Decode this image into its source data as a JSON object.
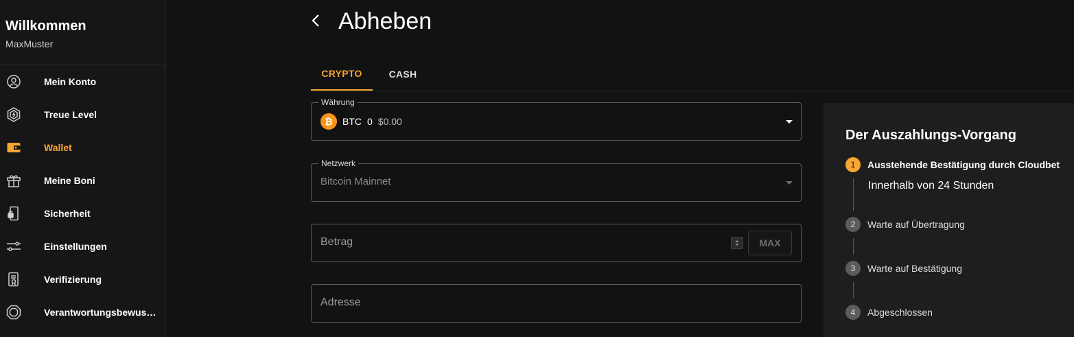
{
  "sidebar": {
    "welcome_title": "Willkommen",
    "username": "MaxMuster",
    "active_color": "#f7a533",
    "items": [
      {
        "label": "Mein Konto",
        "icon": "user-circle-icon"
      },
      {
        "label": "Treue Level",
        "icon": "badge-hexagon-icon"
      },
      {
        "label": "Wallet",
        "icon": "wallet-icon"
      },
      {
        "label": "Meine Boni",
        "icon": "gift-icon"
      },
      {
        "label": "Sicherheit",
        "icon": "phone-lock-icon"
      },
      {
        "label": "Einstellungen",
        "icon": "sliders-icon"
      },
      {
        "label": "Verifizierung",
        "icon": "document-check-icon"
      },
      {
        "label": "Verantwortungsbewuss…",
        "icon": "octagon-icon"
      }
    ]
  },
  "header": {
    "title": "Abheben",
    "back_icon": "chevron-left-icon"
  },
  "tabs": [
    {
      "label": "CRYPTO",
      "active": true
    },
    {
      "label": "CASH",
      "active": false
    }
  ],
  "form": {
    "currency": {
      "legend": "Währung",
      "coin_symbol": "₿",
      "code": "BTC",
      "amount": "0",
      "usd_value": "$0.00"
    },
    "network": {
      "legend": "Netzwerk",
      "value": "Bitcoin Mainnet"
    },
    "amount_placeholder": "Betrag",
    "max_label": "MAX",
    "address_placeholder": "Adresse"
  },
  "process": {
    "title": "Der Auszahlungs-Vorgang",
    "steps": [
      {
        "num": "1",
        "label": "Ausstehende Bestätigung durch Cloudbet",
        "sub": "Innerhalb von 24 Stunden"
      },
      {
        "num": "2",
        "label": "Warte auf Übertragung"
      },
      {
        "num": "3",
        "label": "Warte auf Bestätigung"
      },
      {
        "num": "4",
        "label": "Abgeschlossen"
      }
    ]
  }
}
